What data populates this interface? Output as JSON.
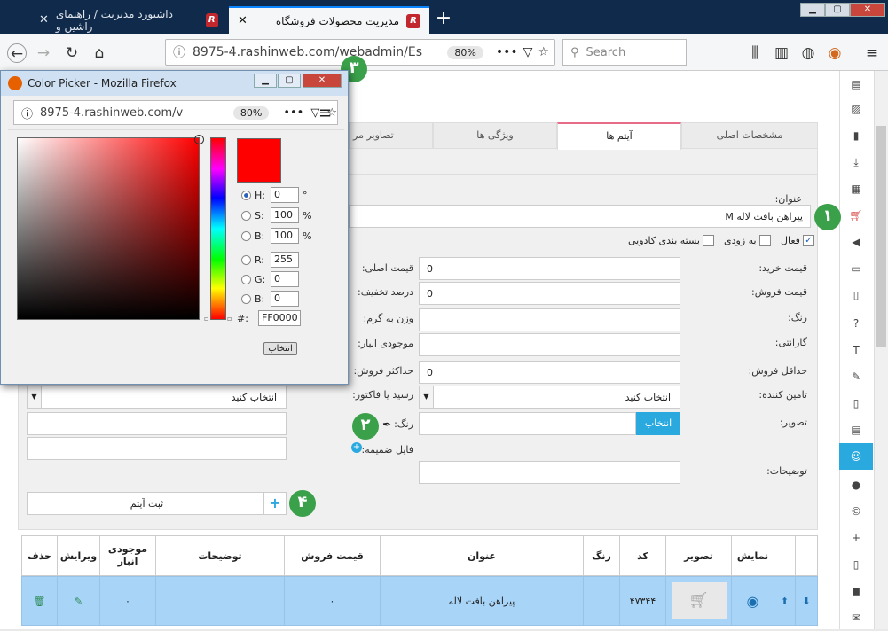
{
  "browser": {
    "tabs": [
      {
        "title": "داشبورد مدیریت / راهنمای راشین و"
      },
      {
        "title": "مدیریت محصولات فروشگاه"
      }
    ],
    "url": "8975-4.rashinweb.com/webadmin/Es",
    "zoom": "80%",
    "search_placeholder": "Search"
  },
  "dialog": {
    "title": "Color Picker - Mozilla Firefox",
    "url": "8975-4.rashinweb.com/v",
    "zoom": "80%",
    "fields": [
      {
        "label": "H:",
        "value": "0",
        "unit": "°"
      },
      {
        "label": "S:",
        "value": "100",
        "unit": "%"
      },
      {
        "label": "B:",
        "value": "100",
        "unit": "%"
      },
      {
        "label": "R:",
        "value": "255",
        "unit": ""
      },
      {
        "label": "G:",
        "value": "0",
        "unit": ""
      },
      {
        "label": "B:",
        "value": "0",
        "unit": ""
      }
    ],
    "hex_label": "#:",
    "hex_value": "FF0000",
    "select_button": "انتخاب",
    "color": "#ff0000"
  },
  "tabs": {
    "main_specs": "مشخصات اصلی",
    "items": "آیتم ها",
    "features": "ویژگی ها",
    "images": "تصاویر مر"
  },
  "form": {
    "title_label": "عنوان:",
    "title_value": "پیراهن بافت لاله M",
    "active_label": "فعال",
    "soon_label": "به زودی",
    "gift_label": "بسته بندی کادویی",
    "purchase_price_label": "قیمت خرید:",
    "sale_price_label": "قیمت فروش:",
    "original_price_label": "قیمت اصلی:",
    "original_price_value": "0",
    "discount_label": "درصد تخفیف:",
    "discount_value": "0",
    "color_label": "رنگ:",
    "weight_label": "وزن به گرم:",
    "warranty_label": "گارانتی:",
    "stock_label": "موجودی انبار:",
    "min_sale_label": "حداقل فروش:",
    "max_sale_label": "حداکثر فروش:",
    "max_sale_value": "0",
    "supplier_label": "تامین کننده:",
    "supplier_value": "انتخاب کنید",
    "invoice_label": "رسید یا فاکتور:",
    "left_select_value": "انتخاب کنید",
    "image_label": "تصویر:",
    "select_button": "انتخاب",
    "color2_label": "رنگ:",
    "attachment_label": "فایل ضمیمه:",
    "description_label": "توضیحات:",
    "register_button": "ثبت آیتم"
  },
  "badges": [
    "۱",
    "۲",
    "۳",
    "۴"
  ],
  "table": {
    "headers": [
      "نمایش",
      "تصویر",
      "کد",
      "رنگ",
      "عنوان",
      "قیمت فروش",
      "توضیحات",
      "موجودی انبار",
      "ویرایش",
      "حذف"
    ],
    "row": {
      "code": "۴۷۳۴۴",
      "title": "پیراهن بافت لاله",
      "price": "۰",
      "stock": "۰"
    }
  },
  "sidebar_icons": [
    "news-icon",
    "image-icon",
    "document-icon",
    "download-icon",
    "film-icon",
    "cart-icon",
    "volume-icon",
    "monitor-icon",
    "book-icon",
    "question-icon",
    "text-icon",
    "pin-icon",
    "file-icon",
    "file-text-icon",
    "users-icon",
    "user-icon",
    "copyright-icon",
    "user-plus-icon",
    "mobile-icon",
    "chat-icon",
    "mail-icon"
  ]
}
